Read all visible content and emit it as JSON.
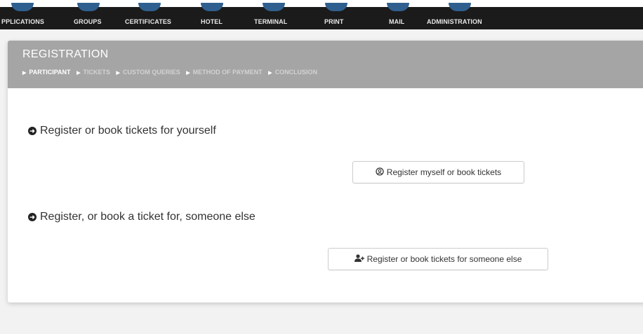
{
  "nav": {
    "items": [
      {
        "label": "PPLICATIONS"
      },
      {
        "label": "GROUPS"
      },
      {
        "label": "CERTIFICATES"
      },
      {
        "label": "HOTEL"
      },
      {
        "label": "TERMINAL"
      },
      {
        "label": "PRINT"
      },
      {
        "label": "MAIL"
      },
      {
        "label": "ADMINISTRATION"
      }
    ]
  },
  "panel": {
    "title": "REGISTRATION",
    "steps": [
      {
        "label": "PARTICIPANT",
        "active": true
      },
      {
        "label": "TICKETS",
        "active": false
      },
      {
        "label": "CUSTOM QUERIES",
        "active": false
      },
      {
        "label": "METHOD OF PAYMENT",
        "active": false
      },
      {
        "label": "CONCLUSION",
        "active": false
      }
    ]
  },
  "options": {
    "self": {
      "heading": "Register or book tickets for yourself",
      "button_label": "Register myself or book tickets",
      "icon": "user-circle-icon"
    },
    "other": {
      "heading": "Register, or book a ticket for, someone else",
      "button_label": "Register or book tickets for someone else",
      "icon": "user-plus-icon"
    }
  },
  "colors": {
    "nav_bg": "#1b1b1b",
    "header_bg": "#a5a5a5",
    "page_bg": "#f2f2f2"
  }
}
